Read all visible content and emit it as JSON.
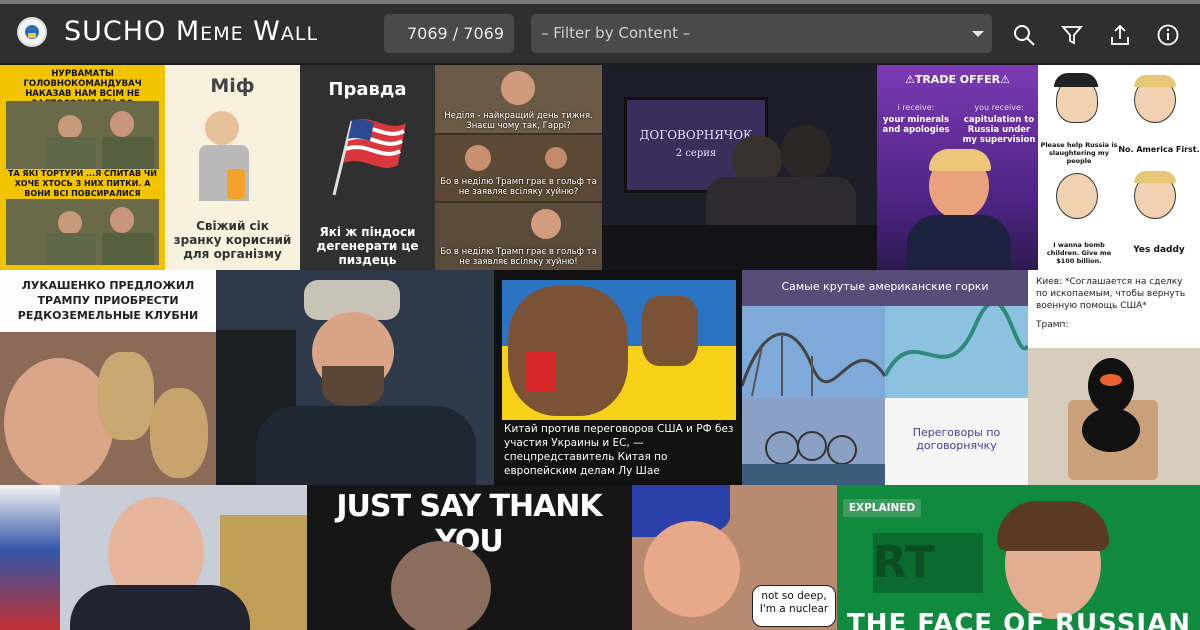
{
  "header": {
    "title": "SUCHO Meme Wall",
    "counter": "7069 / 7069",
    "filter_placeholder": "– Filter by Content –"
  },
  "toolbar": {
    "icons": [
      "search-icon",
      "filter-icon",
      "share-icon",
      "info-icon"
    ]
  },
  "tiles": {
    "t1": {
      "top": "НУРВАМАТЫ ГОЛОВНОКОМАНДУВАЧ НАКАЗАВ НАМ ВСІМ НЕ ЗАСТОСОВУВАТИ ДО ПОЛОНЕНИХ ОРКІВ ТОРТУРИ!",
      "bottom": "ТА ЯКІ ТОРТУРИ ...Я СПИТАВ ЧИ ХОЧЕ ХТОСЬ З НИХ ПИТКИ. А ВОНИ ВСІ ПОВСИРАЛИСЯ"
    },
    "t2": {
      "head": "Міф",
      "body": "Свіжий сік зранку корисний для організму"
    },
    "t3": {
      "head": "Правда",
      "body": "Які ж піндоси дегенерати це пиздець"
    },
    "t4": {
      "c1": "Неділя - найкращий день тижня. Знаєш чому так, Гаррі?",
      "c2": "Бо в неділю Трамп грає в гольф та не заявляє всіляку хуйню?",
      "c3": "Бо в неділю Трамп грає в гольф та не заявляє всіляку хуйню!"
    },
    "t5": {
      "tv": "ДОГОВОРНЯЧОК",
      "tv2": "2 серия"
    },
    "t6": {
      "banner": "⚠TRADE OFFER⚠",
      "receive1": "i receive:",
      "receive1b": "your minerals and apologies",
      "receive2": "you receive:",
      "receive2b": "capitulation to Russia under my supervision"
    },
    "t7": {
      "a": "Please help Russia is slaughtering my people",
      "b": "No. America First.",
      "c": "I wanna bomb children. Give me $100 billion.",
      "d": "Yes daddy"
    },
    "t8": {
      "head": "ЛУКАШЕНКО ПРЕДЛОЖИЛ ТРАМПУ ПРИОБРЕСТИ РЕДКОЗЕМЕЛЬНЫЕ КЛУБНИ"
    },
    "t10": {
      "caption": "Китай против переговоров США и РФ без участия Украины и ЕС, — спецпредставитель Китая по европейским делам Лу Шае"
    },
    "t11": {
      "head": "Самые крутые американские горки",
      "caption": "Переговоры по договорнячку"
    },
    "t12": {
      "text": "Киев: *Соглашается на сделку по ископаемым, чтобы вернуть военную помощь США*",
      "trump": "Трамп:"
    },
    "t14": {
      "head": "JUST SAY THANK YOU"
    },
    "t15": {
      "bubble": "not so deep, I'm a nuclear"
    },
    "t16": {
      "badge": "EXPLAINED",
      "head": "THE FACE OF RUSSIAN"
    }
  }
}
